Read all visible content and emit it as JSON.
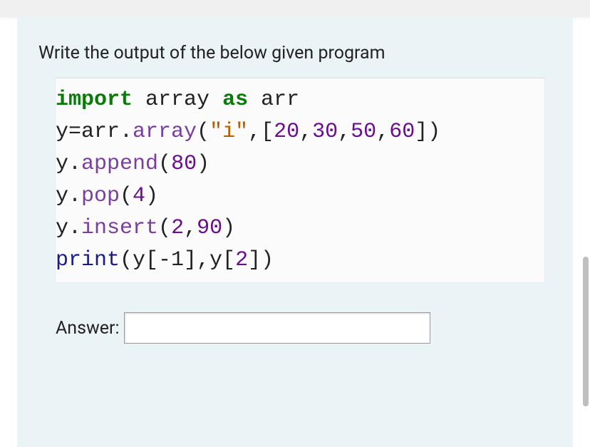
{
  "question": {
    "prompt": "Write the output of the below given program",
    "code_tokens": {
      "l1_import": "import",
      "l1_array": " array ",
      "l1_as": "as",
      "l1_arr": " arr",
      "l2_y": "y=arr.",
      "l2_method": "array",
      "l2_open": "(",
      "l2_str": "\"i\"",
      "l2_mid": ",[",
      "l2_n1": "20",
      "l2_c1": ",",
      "l2_n2": "30",
      "l2_c2": ",",
      "l2_n3": "50",
      "l2_c3": ",",
      "l2_n4": "60",
      "l2_close": "])",
      "l3_y": "y.",
      "l3_method": "append",
      "l3_open": "(",
      "l3_n": "80",
      "l3_close": ")",
      "l4_y": "y.",
      "l4_method": "pop",
      "l4_open": "(",
      "l4_n": "4",
      "l4_close": ")",
      "l5_y": "y.",
      "l5_method": "insert",
      "l5_open": "(",
      "l5_n1": "2",
      "l5_c": ",",
      "l5_n2": "90",
      "l5_close": ")",
      "l6_print": "print",
      "l6_open": "(y[",
      "l6_neg1": "-1",
      "l6_mid": "],y[",
      "l6_n2": "2",
      "l6_close": "])"
    },
    "answer_label": "Answer:",
    "answer_value": ""
  }
}
